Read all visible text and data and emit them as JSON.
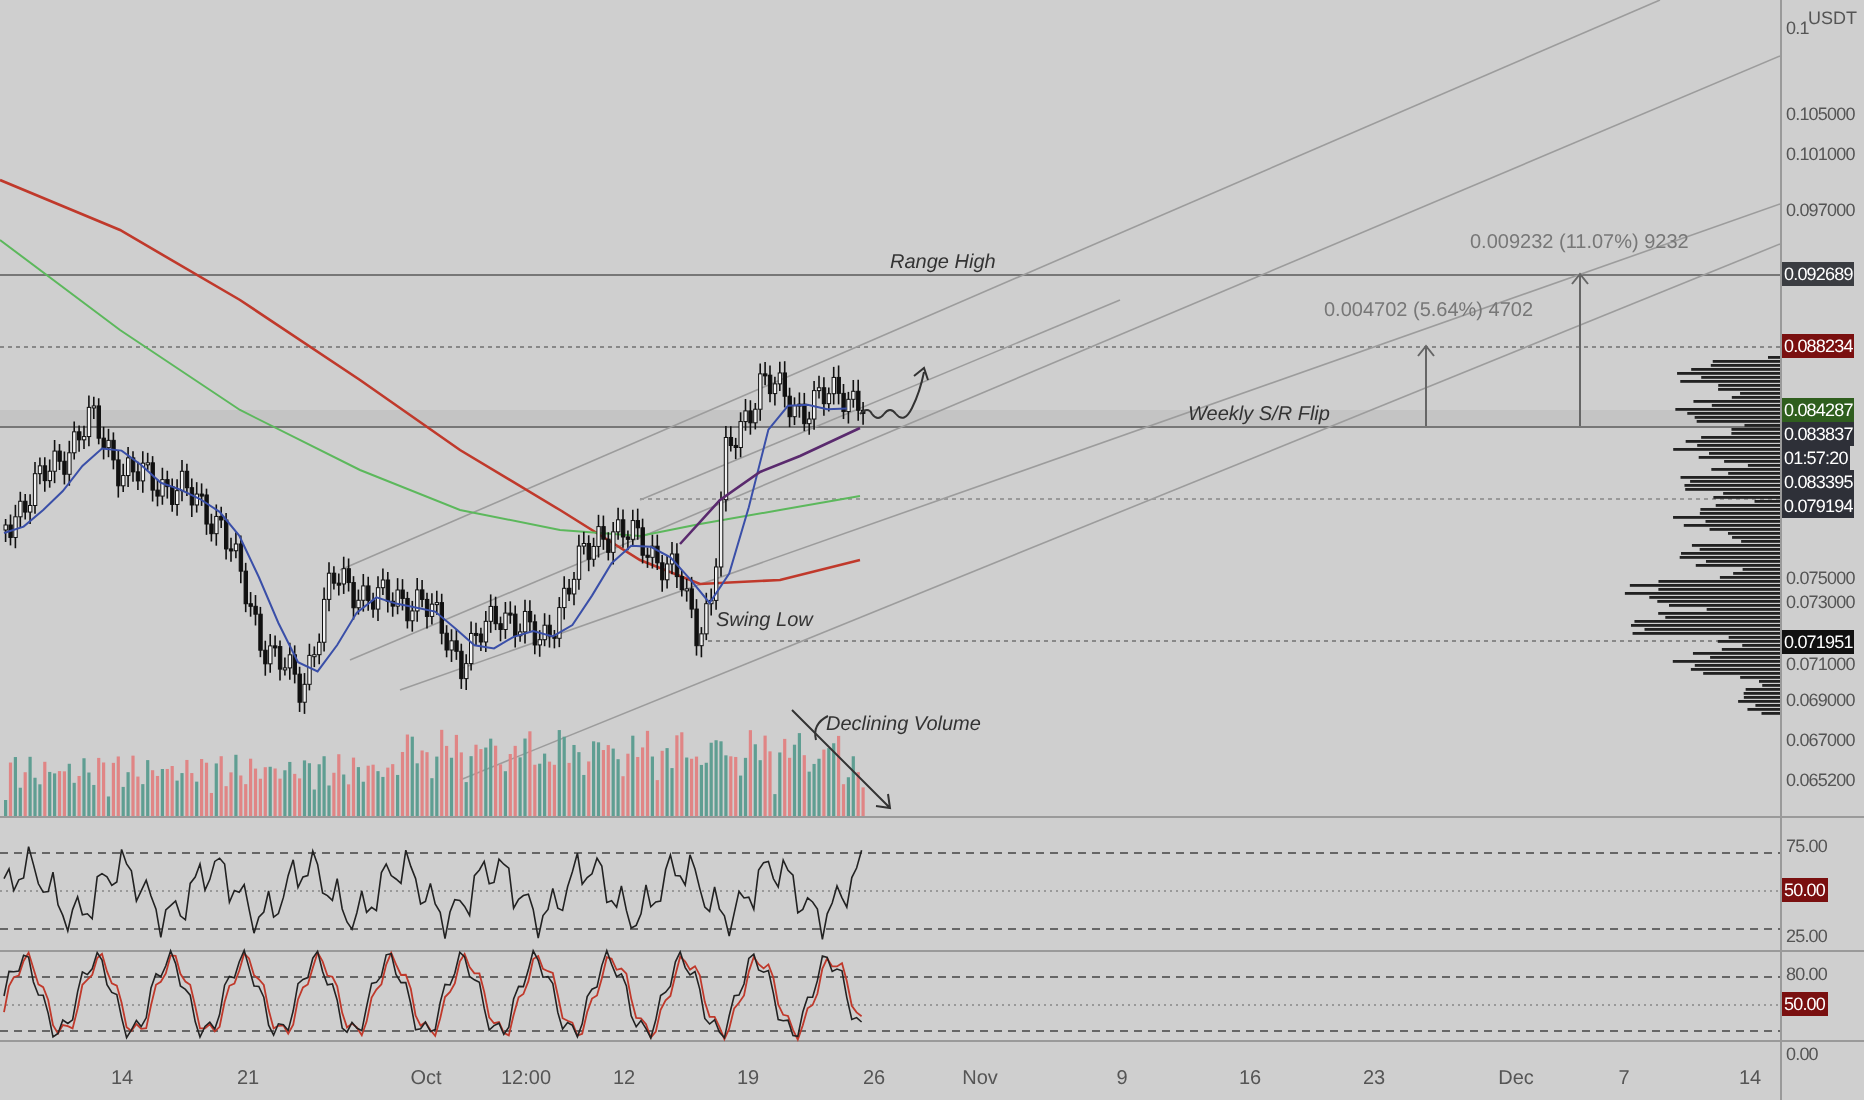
{
  "price_axis": {
    "unit": "USDT",
    "labels": [
      {
        "label": "0.1",
        "kind": "tick"
      },
      {
        "label": "0.105000",
        "kind": "tick"
      },
      {
        "label": "0.101000",
        "kind": "tick"
      },
      {
        "label": "0.097000",
        "kind": "tick"
      },
      {
        "label": "0.092689",
        "kind": "badge",
        "color": "#3b3d42"
      },
      {
        "label": "0.088234",
        "kind": "badge",
        "color": "#7a1010"
      },
      {
        "label": "0.084287",
        "kind": "badge",
        "color": "#2f5e1e"
      },
      {
        "label": "0.083837",
        "kind": "badge",
        "color": "#2e3038"
      },
      {
        "label": "01:57:20",
        "kind": "badge",
        "color": "#2e3038"
      },
      {
        "label": "0.083395",
        "kind": "badge",
        "color": "#2e3038"
      },
      {
        "label": "0.079194",
        "kind": "badge",
        "color": "#2e3038"
      },
      {
        "label": "0.075000",
        "kind": "tick"
      },
      {
        "label": "0.073000",
        "kind": "tick"
      },
      {
        "label": "0.071951",
        "kind": "badge",
        "color": "#111111"
      },
      {
        "label": "0.071000",
        "kind": "tick"
      },
      {
        "label": "0.069000",
        "kind": "tick"
      },
      {
        "label": "0.067000",
        "kind": "tick"
      },
      {
        "label": "0.065200",
        "kind": "tick"
      }
    ]
  },
  "rsi_axis": [
    {
      "label": "75.00",
      "kind": "tick"
    },
    {
      "label": "50.00",
      "kind": "badge",
      "color": "#7a1010"
    },
    {
      "label": "25.00",
      "kind": "tick"
    }
  ],
  "stoch_axis": [
    {
      "label": "80.00",
      "kind": "tick"
    },
    {
      "label": "50.00",
      "kind": "badge",
      "color": "#7a1010"
    },
    {
      "label": "0.00",
      "kind": "tick"
    }
  ],
  "annotations": [
    {
      "text": "Range High",
      "kind": "note"
    },
    {
      "text": "0.009232 (11.07%) 9232",
      "kind": "measure"
    },
    {
      "text": "0.004702 (5.64%) 4702",
      "kind": "measure"
    },
    {
      "text": "Weekly S/R Flip",
      "kind": "note"
    },
    {
      "text": "Swing Low",
      "kind": "note"
    },
    {
      "text": "Declining Volume",
      "kind": "note"
    }
  ],
  "time_axis": [
    "14",
    "21",
    "Oct",
    "12:00",
    "12",
    "19",
    "26",
    "Nov",
    "9",
    "16",
    "23",
    "Dec",
    "7",
    "14"
  ]
}
